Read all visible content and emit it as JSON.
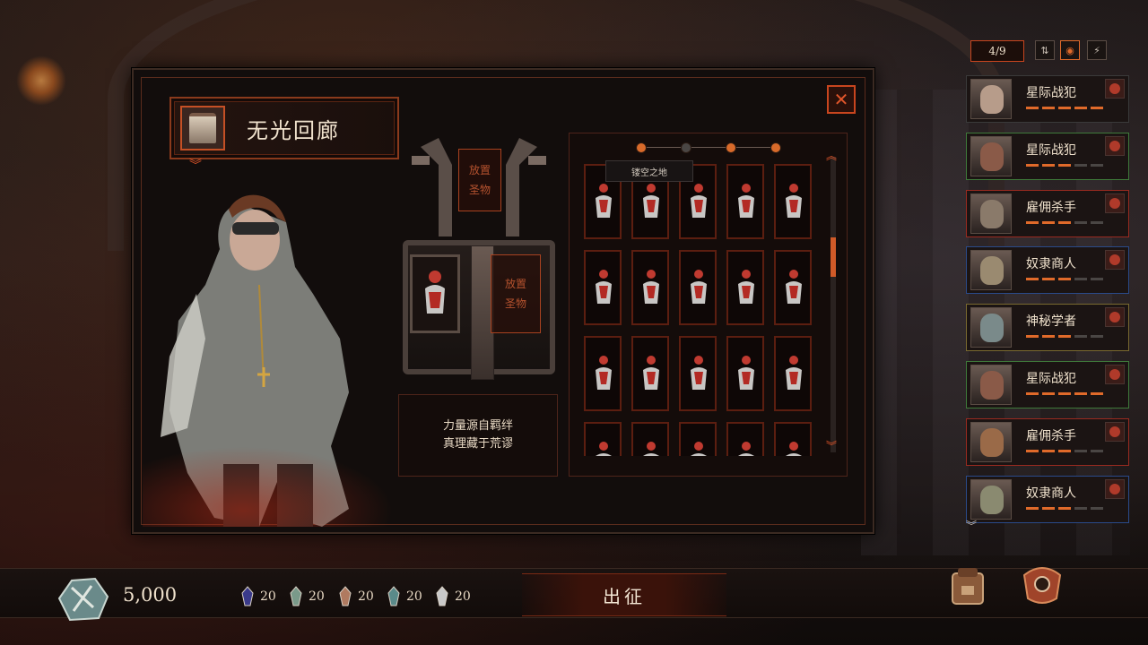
{
  "location": {
    "title": "无光回廊",
    "relic_icon": "relic-altar-icon"
  },
  "altar": {
    "slot_top_label": "放置\n圣物",
    "slot_right_label": "放置\n圣物"
  },
  "quote": {
    "line1": "力量源自羁绊",
    "line2": "真理藏于荒谬"
  },
  "grid": {
    "tooltip": "镂空之地",
    "pages": 4,
    "active_page_index": 1,
    "cards": 20
  },
  "roster": {
    "count": "4/9",
    "heroes": [
      {
        "name": "星际战犯",
        "frame": "#3a3a3a",
        "face": "#b79c8a",
        "level": 5
      },
      {
        "name": "星际战犯",
        "frame": "#3f7a3a",
        "face": "#8a5a48",
        "level": 3
      },
      {
        "name": "雇佣杀手",
        "frame": "#9a2a20",
        "face": "#8a7a6a",
        "level": 3
      },
      {
        "name": "奴隶商人",
        "frame": "#2a4a8a",
        "face": "#9a8a70",
        "level": 3
      },
      {
        "name": "神秘学者",
        "frame": "#7a6a30",
        "face": "#7a8a8a",
        "level": 3
      },
      {
        "name": "星际战犯",
        "frame": "#3f7a3a",
        "face": "#8a5a48",
        "level": 5
      },
      {
        "name": "雇佣杀手",
        "frame": "#9a2a20",
        "face": "#9a6a48",
        "level": 3
      },
      {
        "name": "奴隶商人",
        "frame": "#2a4a8a",
        "face": "#8a8a70",
        "level": 3
      }
    ]
  },
  "bottom": {
    "currency": "5,000",
    "resources": [
      {
        "icon": "dark-crystal-icon",
        "value": "20",
        "color": "#3a3a8a"
      },
      {
        "icon": "mushroom-icon",
        "value": "20",
        "color": "#7a9a8a"
      },
      {
        "icon": "flesh-shard-icon",
        "value": "20",
        "color": "#b07a60"
      },
      {
        "icon": "teal-crystal-icon",
        "value": "20",
        "color": "#5a8a8a"
      },
      {
        "icon": "star-core-icon",
        "value": "20",
        "color": "#c9c9c9"
      }
    ],
    "depart_label": "出征"
  },
  "colors": {
    "accent": "#e0552a",
    "frame": "#5c1e10"
  }
}
